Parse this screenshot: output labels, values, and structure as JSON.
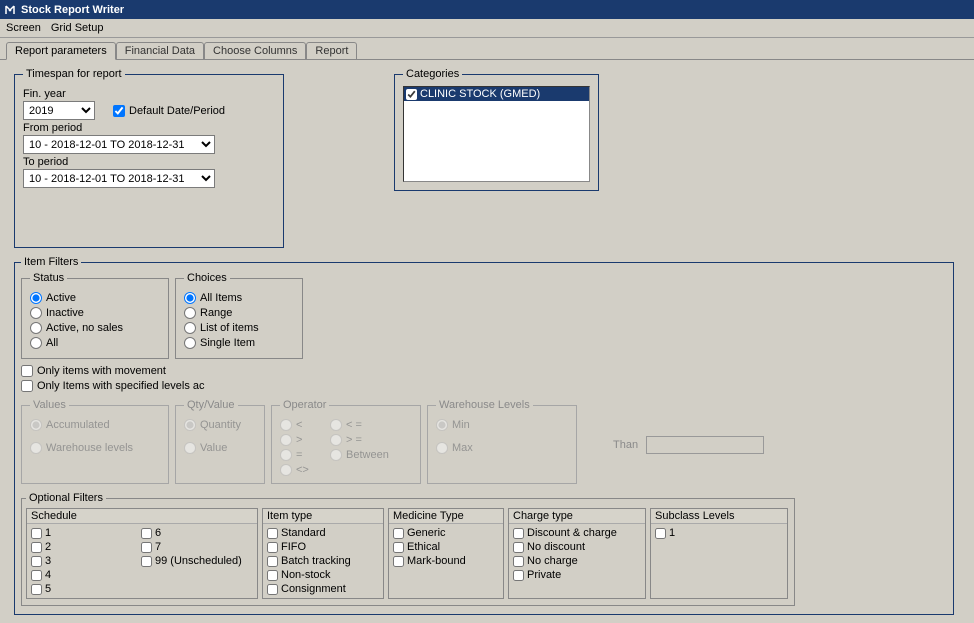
{
  "window": {
    "title": "Stock Report Writer"
  },
  "menu": {
    "screen": "Screen",
    "grid_setup": "Grid Setup"
  },
  "tabs": [
    {
      "label": "Report parameters",
      "active": true
    },
    {
      "label": "Financial Data",
      "active": false
    },
    {
      "label": "Choose Columns",
      "active": false
    },
    {
      "label": "Report",
      "active": false
    }
  ],
  "timespan": {
    "legend": "Timespan for report",
    "fin_year_label": "Fin. year",
    "fin_year_value": "2019",
    "default_date_label": "Default Date/Period",
    "from_label": "From period",
    "from_value": "10 - 2018-12-01 TO 2018-12-31",
    "to_label": "To period",
    "to_value": "10 - 2018-12-01 TO 2018-12-31"
  },
  "categories": {
    "legend": "Categories",
    "items": [
      {
        "label": "CLINIC STOCK  (GMED)",
        "checked": true
      }
    ]
  },
  "item_filters": {
    "legend": "Item Filters",
    "status": {
      "legend": "Status",
      "options": [
        "Active",
        "Inactive",
        "Active, no sales",
        "All"
      ],
      "selected": "Active"
    },
    "choices": {
      "legend": "Choices",
      "options": [
        "All Items",
        "Range",
        "List of items",
        "Single Item"
      ],
      "selected": "All Items"
    },
    "only_movement": "Only items with movement",
    "only_levels": "Only Items with specified levels ac",
    "values": {
      "legend": "Values",
      "options": [
        "Accumulated",
        "Warehouse levels"
      ],
      "selected": "Accumulated"
    },
    "qty": {
      "legend": "Qty/Value",
      "options": [
        "Quantity",
        "Value"
      ],
      "selected": "Quantity"
    },
    "operator": {
      "legend": "Operator",
      "col1": [
        "<",
        ">",
        "=",
        "<>"
      ],
      "col2": [
        "< =",
        "> =",
        "Between"
      ]
    },
    "warehouse": {
      "legend": "Warehouse Levels",
      "options": [
        "Min",
        "Max"
      ],
      "selected": "Min"
    },
    "than_label": "Than"
  },
  "optional": {
    "legend": "Optional Filters",
    "schedule": {
      "header": "Schedule",
      "col1": [
        "1",
        "2",
        "3",
        "4",
        "5"
      ],
      "col2": [
        "6",
        "7",
        "99 (Unscheduled)"
      ]
    },
    "itemtype": {
      "header": "Item type",
      "items": [
        "Standard",
        "FIFO",
        "Batch tracking",
        "Non-stock",
        "Consignment"
      ]
    },
    "medtype": {
      "header": "Medicine Type",
      "items": [
        "Generic",
        "Ethical",
        "Mark-bound"
      ]
    },
    "chargetype": {
      "header": "Charge type",
      "items": [
        "Discount & charge",
        "No discount",
        "No charge",
        "Private"
      ]
    },
    "subclass": {
      "header": "Subclass Levels",
      "items": [
        "1"
      ]
    }
  }
}
